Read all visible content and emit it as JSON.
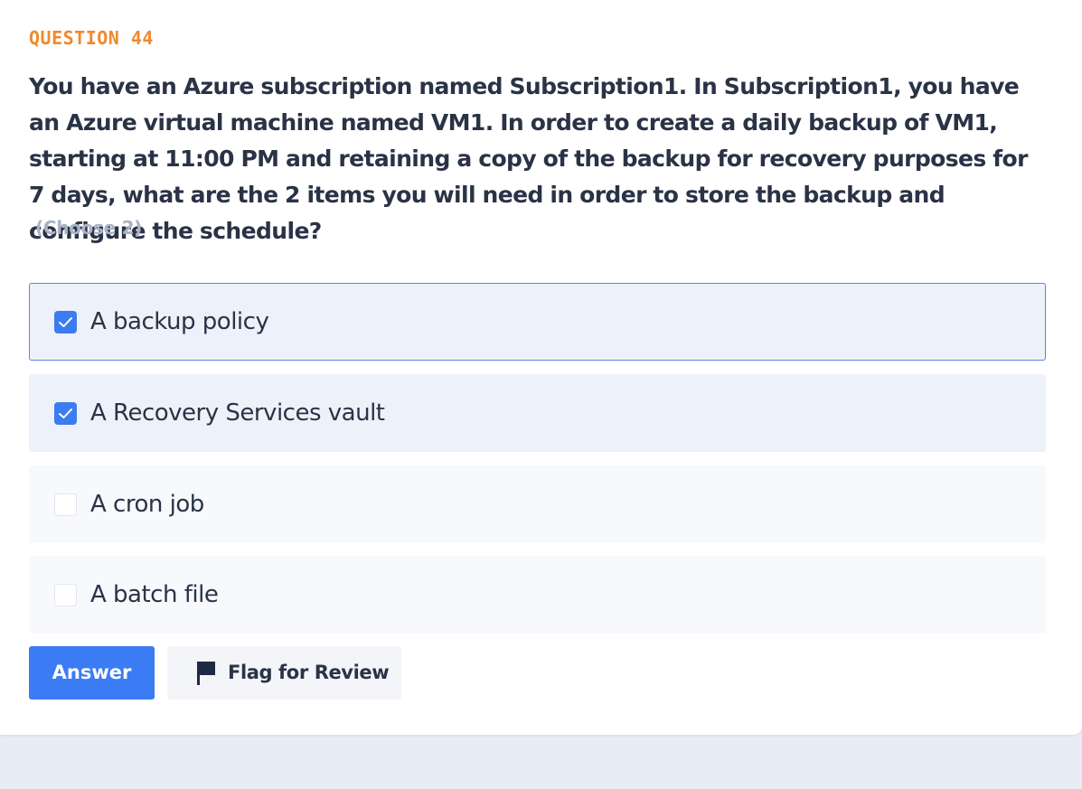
{
  "question": {
    "number_label": "QUESTION 44",
    "text": "You have an Azure subscription named Subscription1. In Subscription1, you have an Azure virtual machine named VM1. In order to create a daily backup of VM1, starting at 11:00 PM and retaining a copy of the backup for recovery purposes for 7 days, what are the 2 items you will need in order to store the backup and configure the schedule?",
    "hint": "(Choose 2)"
  },
  "options": [
    {
      "label": "A backup policy",
      "checked": true
    },
    {
      "label": "A Recovery Services vault",
      "checked": true
    },
    {
      "label": "A cron job",
      "checked": false
    },
    {
      "label": "A batch file",
      "checked": false
    }
  ],
  "buttons": {
    "answer_label": "Answer",
    "flag_label": "Flag for Review"
  },
  "colors": {
    "accent": "#3b7cf5",
    "question_number": "#f0892c",
    "hint": "#a8b3c6"
  },
  "icons": {
    "check": "check-icon",
    "flag": "flag-icon"
  }
}
